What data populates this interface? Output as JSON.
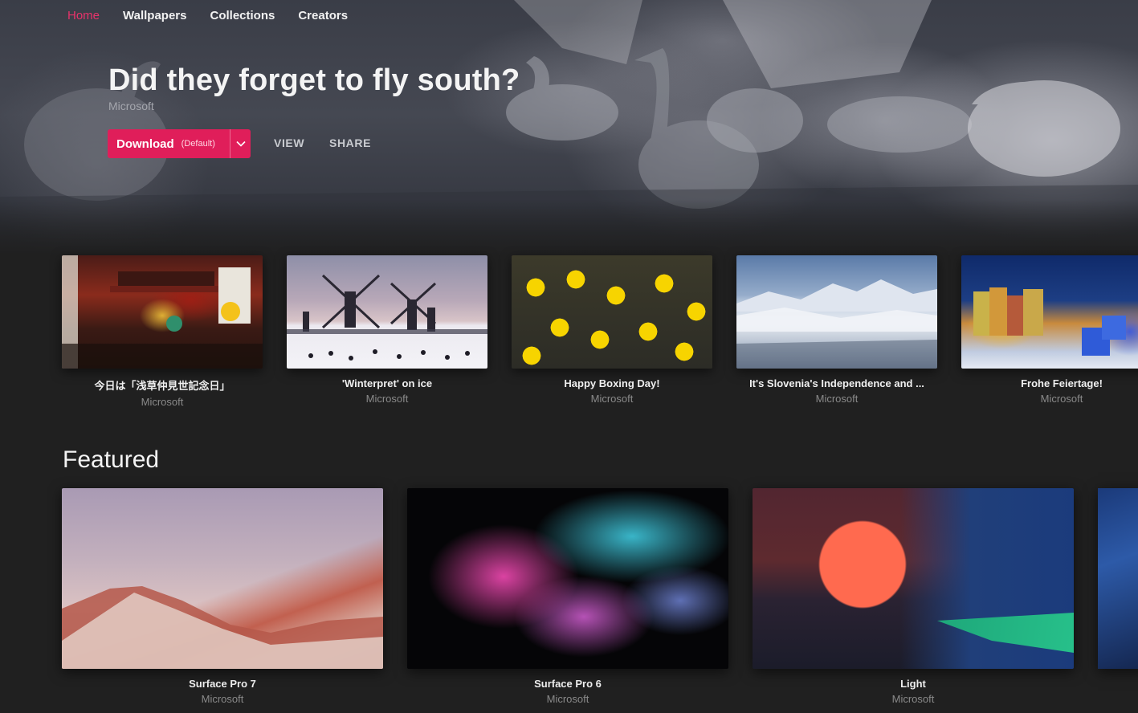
{
  "nav": {
    "items": [
      {
        "label": "Home",
        "active": true
      },
      {
        "label": "Wallpapers",
        "active": false
      },
      {
        "label": "Collections",
        "active": false
      },
      {
        "label": "Creators",
        "active": false
      }
    ]
  },
  "hero": {
    "title": "Did they forget to fly south?",
    "author": "Microsoft",
    "download_label": "Download",
    "download_tag": "(Default)",
    "view_label": "VIEW",
    "share_label": "SHARE",
    "accent_color": "#e01e5a"
  },
  "daily": [
    {
      "title": "今日は「浅草仲見世記念日」",
      "author": "Microsoft"
    },
    {
      "title": "'Winterpret' on ice",
      "author": "Microsoft"
    },
    {
      "title": "Happy Boxing Day!",
      "author": "Microsoft"
    },
    {
      "title": "It's Slovenia's Independence and ...",
      "author": "Microsoft"
    },
    {
      "title": "Frohe Feiertage!",
      "author": "Microsoft"
    }
  ],
  "featured": {
    "heading": "Featured",
    "items": [
      {
        "title": "Surface Pro 7",
        "author": "Microsoft"
      },
      {
        "title": "Surface Pro 6",
        "author": "Microsoft"
      },
      {
        "title": "Light",
        "author": "Microsoft"
      }
    ]
  }
}
